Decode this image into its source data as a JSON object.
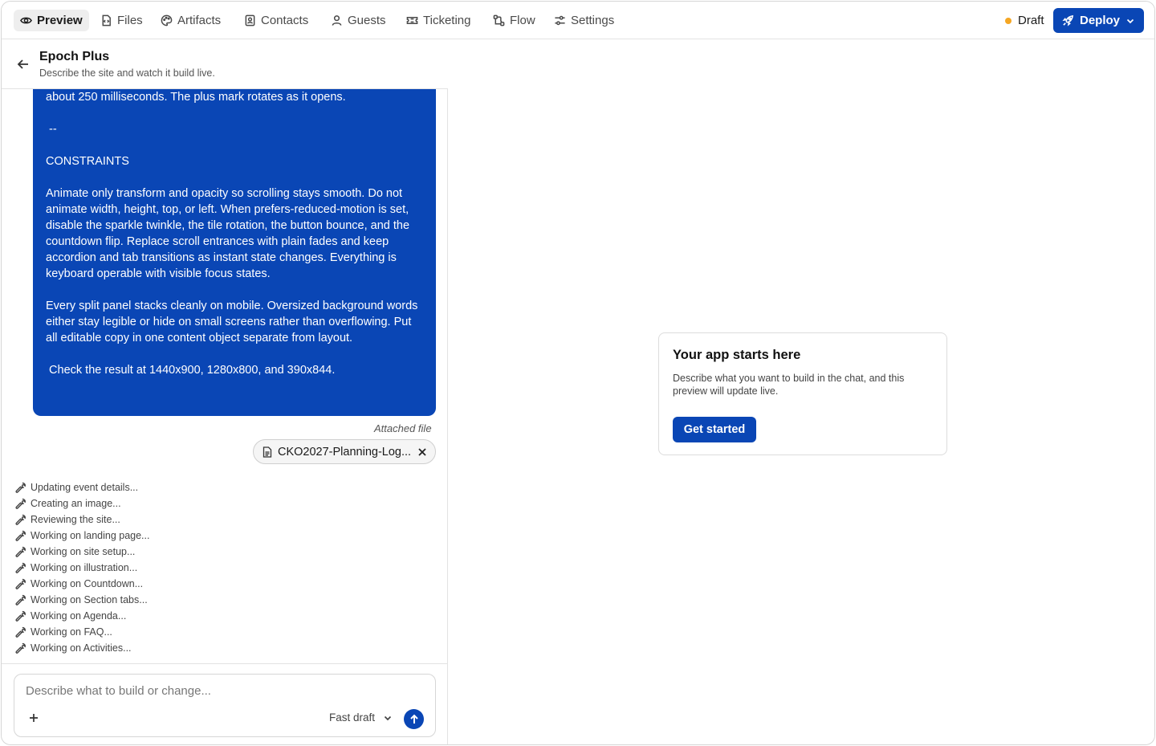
{
  "nav": {
    "tabs": [
      {
        "label": "Preview",
        "icon": "eye-icon",
        "active": true
      },
      {
        "label": "Files",
        "icon": "file-code-icon"
      },
      {
        "label": "Artifacts",
        "icon": "palette-icon"
      },
      {
        "label": "Contacts",
        "icon": "contact-card-icon"
      },
      {
        "label": "Guests",
        "icon": "user-icon"
      },
      {
        "label": "Ticketing",
        "icon": "ticket-icon"
      },
      {
        "label": "Flow",
        "icon": "flow-icon"
      },
      {
        "label": "Settings",
        "icon": "sliders-icon"
      }
    ],
    "status_label": "Draft",
    "status_color": "#f5a623",
    "deploy_label": "Deploy"
  },
  "project": {
    "title": "Epoch Plus",
    "subtitle": "Describe the site and watch it build live."
  },
  "message": {
    "lines": [
      "about 250 milliseconds. The plus mark rotates as it opens.",
      "",
      " --",
      "",
      "CONSTRAINTS",
      "",
      "Animate only transform and opacity so scrolling stays smooth. Do not animate width, height, top, or left. When prefers-reduced-motion is set, disable the sparkle twinkle, the tile rotation, the button bounce, and the countdown flip. Replace scroll entrances with plain fades and keep accordion and tab transitions as instant state changes. Everything is keyboard operable with visible focus states.",
      "",
      "Every split panel stacks cleanly on mobile. Oversized background words either stay legible or hide on small screens rather than overflowing. Put all editable copy in one content object separate from layout.",
      "",
      " Check the result at 1440x900, 1280x800, and 390x844."
    ],
    "attached_label": "Attached file",
    "attached_file": "CKO2027-Planning-Log..."
  },
  "steps": [
    "Updating event details...",
    "Creating an image...",
    "Reviewing the site...",
    "Working on landing page...",
    "Working on site setup...",
    "Working on illustration...",
    "Working on Countdown...",
    "Working on Section tabs...",
    "Working on Agenda...",
    "Working on FAQ...",
    "Working on Activities..."
  ],
  "composer": {
    "placeholder": "Describe what to build or change...",
    "mode": "Fast draft"
  },
  "preview": {
    "title": "Your app starts here",
    "description": "Describe what you want to build in the chat, and this preview will update live.",
    "button": "Get started"
  },
  "colors": {
    "accent": "#0a46b5"
  }
}
